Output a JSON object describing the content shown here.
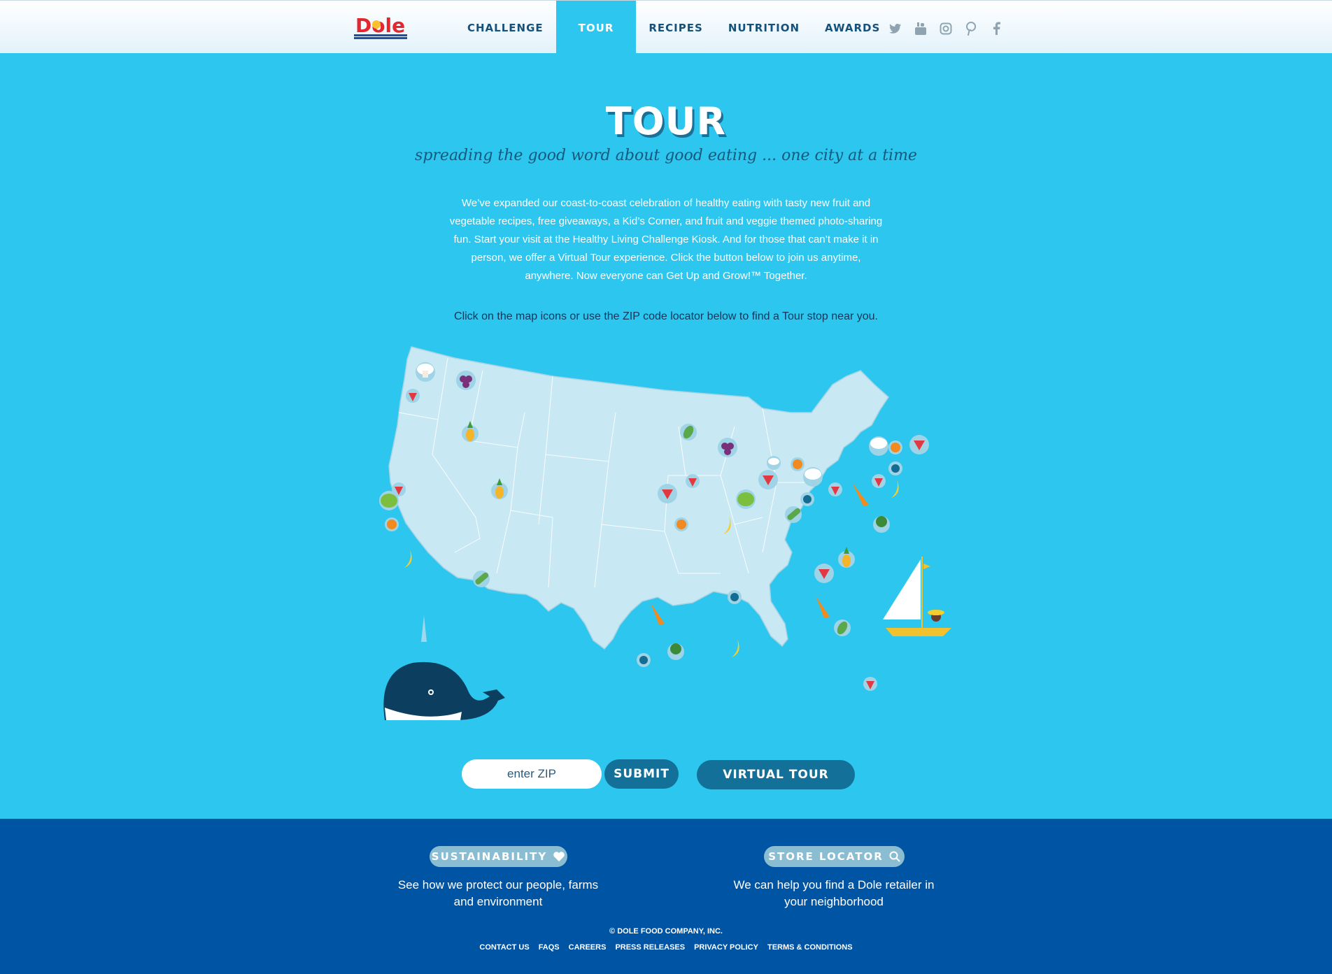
{
  "brand": {
    "logo_text": "Dole"
  },
  "nav": {
    "items": [
      {
        "label": "CHALLENGE"
      },
      {
        "label": "TOUR"
      },
      {
        "label": "RECIPES"
      },
      {
        "label": "NUTRITION"
      },
      {
        "label": "AWARDS"
      }
    ],
    "active": "TOUR"
  },
  "social": [
    "twitter-icon",
    "youtube-icon",
    "instagram-icon",
    "pinterest-icon",
    "facebook-icon"
  ],
  "hero": {
    "title": "TOUR",
    "subtitle": "spreading the good word about good eating ... one city at a time",
    "intro": "We’ve expanded our coast-to-coast celebration of healthy eating with tasty new fruit and vegetable recipes, free giveaways, a Kid’s Corner, and fruit and veggie themed photo-sharing fun. Start your visit at the Healthy Living Challenge Kiosk. And for those that can’t make it in person, we offer a Virtual Tour experience. Click the button below to join us anytime, anywhere. Now everyone can Get Up and Grow!™ Together.",
    "instruction": "Click on the map icons or use the ZIP code locator below to find a Tour stop near you."
  },
  "map": {
    "markers": [
      "mushroom",
      "grapes",
      "strawberry",
      "pineapple",
      "spinach",
      "grapes",
      "mushroom",
      "orange",
      "strawberry",
      "orange",
      "strawberry",
      "lettuce",
      "strawberry",
      "pineapple",
      "lettuce",
      "orange",
      "banana",
      "zucchini",
      "pineapple",
      "strawberry",
      "banana",
      "zucchini",
      "dot",
      "strawberry",
      "carrot",
      "mushroom",
      "dot",
      "strawberry",
      "carrot",
      "broccoli",
      "banana",
      "dot",
      "pineapple",
      "strawberry",
      "carrot",
      "dot",
      "spinach",
      "broccoli",
      "banana",
      "dot",
      "strawberry",
      "mushroom",
      "strawberry",
      "orange"
    ]
  },
  "locator": {
    "zip_placeholder": "enter ZIP",
    "submit_label": "SUBMIT",
    "virtual_label": "VIRTUAL TOUR"
  },
  "footer": {
    "sustainability": {
      "label": "SUSTAINABILITY",
      "text": "See how we protect our people, farms and environment"
    },
    "store": {
      "label": "STORE LOCATOR",
      "text": "We can help you find a Dole retailer in your neighborhood"
    },
    "copyright": "© DOLE FOOD COMPANY, INC.",
    "links": [
      "CONTACT US",
      "FAQS",
      "CAREERS",
      "PRESS RELEASES",
      "PRIVACY POLICY",
      "TERMS & CONDITIONS"
    ]
  },
  "colors": {
    "sky": "#2cc6ef",
    "map": "#c5e9f4",
    "footer": "#0054a4",
    "button": "#137098"
  }
}
